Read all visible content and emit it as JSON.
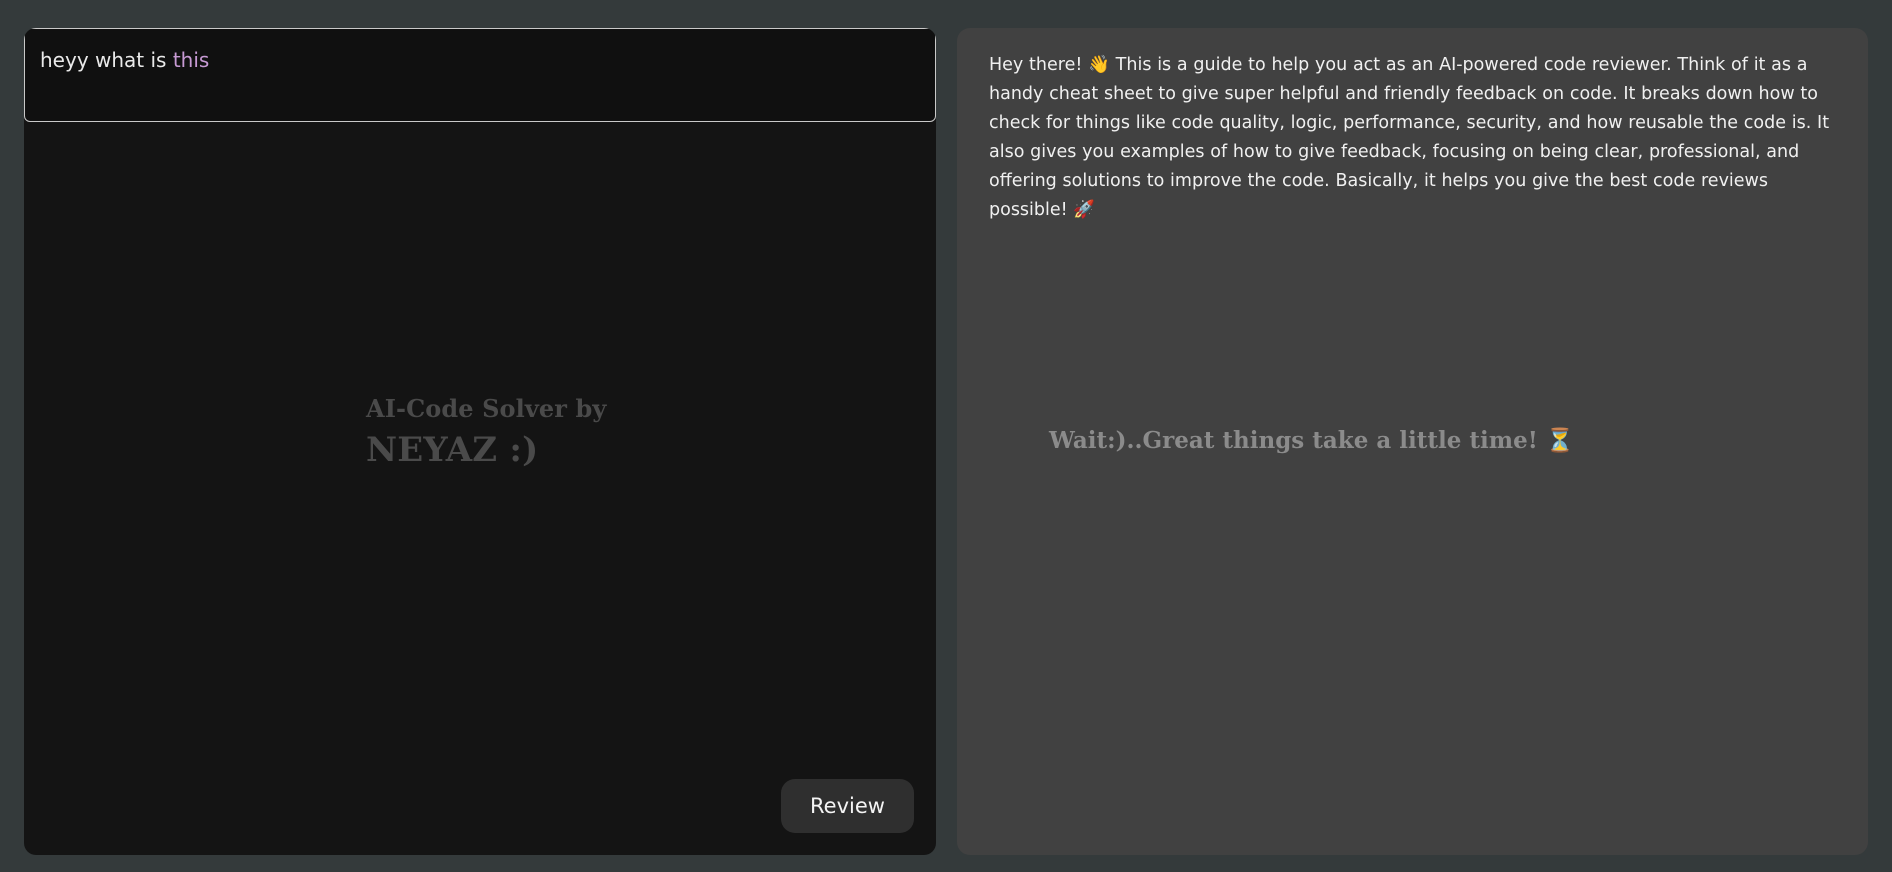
{
  "editor": {
    "code_prefix": "heyy what is ",
    "code_keyword": "this"
  },
  "watermark": {
    "line1": "AI-Code Solver by",
    "line2": "NEYAZ :)"
  },
  "actions": {
    "review_label": "Review"
  },
  "review_panel": {
    "response_text": "Hey there! 👋 This is a guide to help you act as an AI-powered code reviewer. Think of it as a handy cheat sheet to give super helpful and friendly feedback on code. It breaks down how to check for things like code quality, logic, performance, security, and how reusable the code is. It also gives you examples of how to give feedback, focusing on being clear, professional, and offering solutions to improve the code. Basically, it helps you give the best code reviews possible! 🚀",
    "loading_message": "Wait:)..Great things take a little time! ⏳"
  },
  "colors": {
    "page_background": "#343a3b",
    "editor_background": "#141414",
    "review_panel_background": "#414141",
    "code_keyword": "#c79ad4",
    "button_background": "#2f2f2f"
  },
  "icons": {
    "wave": "waving-hand-icon",
    "rocket": "rocket-icon",
    "hourglass": "hourglass-icon"
  }
}
